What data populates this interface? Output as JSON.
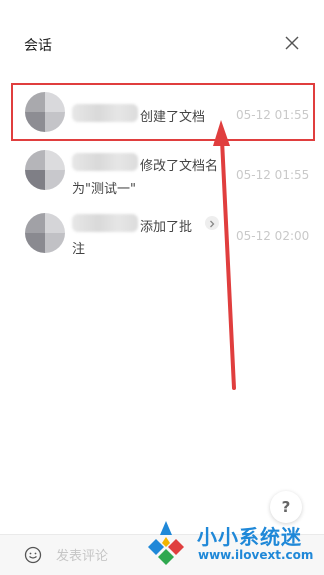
{
  "header": {
    "title": "会话"
  },
  "items": [
    {
      "action": "创建了文档",
      "time": "05-12 01:55"
    },
    {
      "action": "修改了文档名",
      "action_line2": "为\"测试一\"",
      "time": "05-12 01:55"
    },
    {
      "action": "添加了批",
      "action_line2": "注",
      "time": "05-12 02:00"
    }
  ],
  "comment": {
    "placeholder": "发表评论"
  },
  "help": {
    "label": "?"
  },
  "watermark": {
    "name": "小小系统迷",
    "url": "www.ilovext.com"
  },
  "colors": {
    "highlight": "#e03e3e",
    "brand": "#1f88d8"
  }
}
